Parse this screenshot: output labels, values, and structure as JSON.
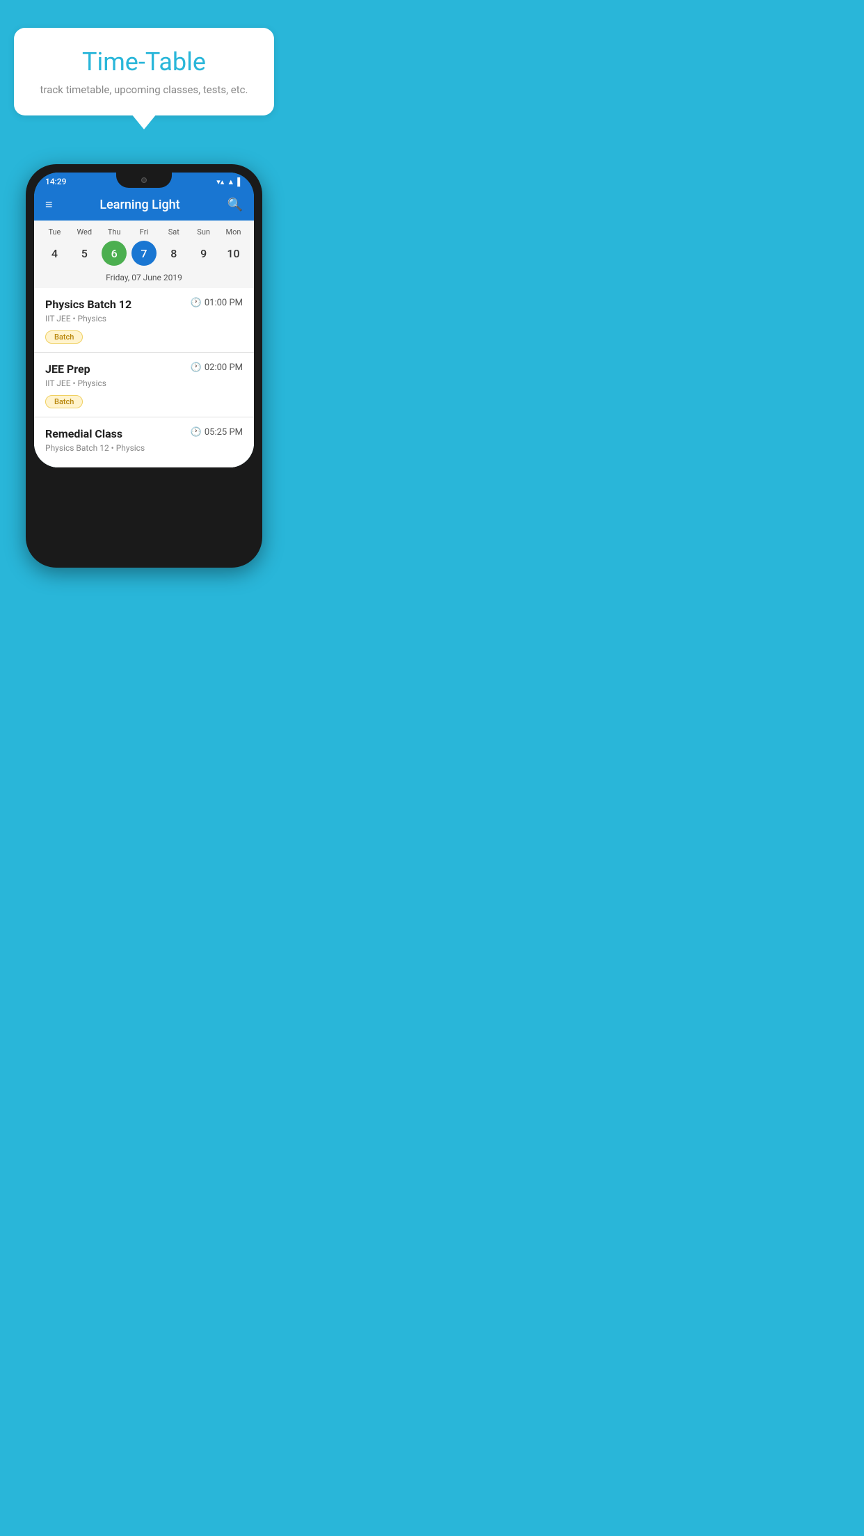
{
  "background_color": "#29B6D9",
  "bubble": {
    "title": "Time-Table",
    "subtitle": "track timetable, upcoming classes, tests, etc."
  },
  "phone": {
    "status_bar": {
      "time": "14:29",
      "icons": [
        "▼",
        "▲",
        "▌"
      ]
    },
    "app_header": {
      "title": "Learning Light",
      "hamburger_label": "≡",
      "search_label": "🔍"
    },
    "calendar": {
      "days": [
        {
          "name": "Tue",
          "num": "4",
          "state": "normal"
        },
        {
          "name": "Wed",
          "num": "5",
          "state": "normal"
        },
        {
          "name": "Thu",
          "num": "6",
          "state": "today"
        },
        {
          "name": "Fri",
          "num": "7",
          "state": "selected"
        },
        {
          "name": "Sat",
          "num": "8",
          "state": "normal"
        },
        {
          "name": "Sun",
          "num": "9",
          "state": "normal"
        },
        {
          "name": "Mon",
          "num": "10",
          "state": "normal"
        }
      ],
      "selected_date_label": "Friday, 07 June 2019"
    },
    "classes": [
      {
        "name": "Physics Batch 12",
        "time": "01:00 PM",
        "details": "IIT JEE • Physics",
        "badge": "Batch"
      },
      {
        "name": "JEE Prep",
        "time": "02:00 PM",
        "details": "IIT JEE • Physics",
        "badge": "Batch"
      },
      {
        "name": "Remedial Class",
        "time": "05:25 PM",
        "details": "Physics Batch 12 • Physics",
        "badge": null
      }
    ]
  }
}
